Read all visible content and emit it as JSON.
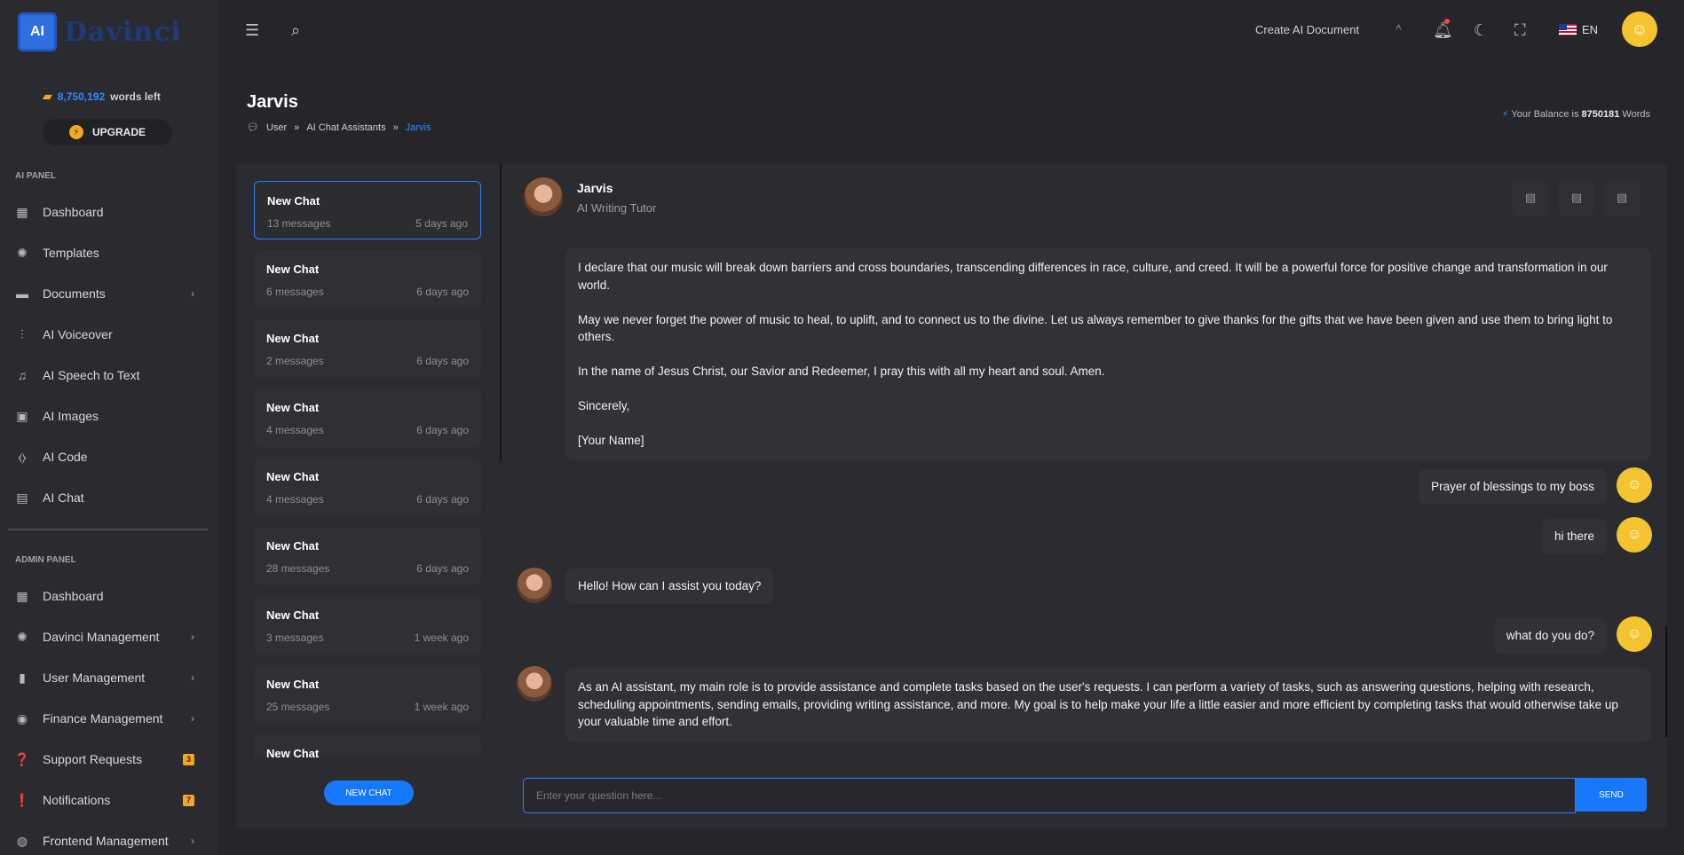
{
  "brand": {
    "logo_mark": "AI",
    "logo_text": "Davinci"
  },
  "colors": {
    "accent": "#1677ff",
    "badge": "#f5a623",
    "background": "#25262c"
  },
  "sidebar": {
    "words_count": "8,750,192",
    "words_label": "words left",
    "upgrade_label": "UPGRADE",
    "ai_panel_label": "AI PANEL",
    "ai_items": [
      {
        "label": "Dashboard",
        "icon": "dashboard-icon"
      },
      {
        "label": "Templates",
        "icon": "templates-icon"
      },
      {
        "label": "Documents",
        "icon": "folder-icon",
        "chevron": true
      },
      {
        "label": "AI Voiceover",
        "icon": "waveform-icon"
      },
      {
        "label": "AI Speech to Text",
        "icon": "audio-file-icon"
      },
      {
        "label": "AI Images",
        "icon": "image-icon"
      },
      {
        "label": "AI Code",
        "icon": "code-icon"
      },
      {
        "label": "AI Chat",
        "icon": "chat-icon"
      }
    ],
    "admin_panel_label": "ADMIN PANEL",
    "admin_items": [
      {
        "label": "Dashboard",
        "icon": "dashboard-icon"
      },
      {
        "label": "Davinci Management",
        "icon": "chip-icon",
        "chevron": true
      },
      {
        "label": "User Management",
        "icon": "user-badge-icon",
        "chevron": true
      },
      {
        "label": "Finance Management",
        "icon": "money-bag-icon",
        "chevron": true
      },
      {
        "label": "Support Requests",
        "icon": "question-icon",
        "badge": "3"
      },
      {
        "label": "Notifications",
        "icon": "alert-icon",
        "badge": "7"
      },
      {
        "label": "Frontend Management",
        "icon": "globe-icon",
        "chevron": true
      }
    ]
  },
  "topbar": {
    "create_doc_label": "Create AI Document",
    "language": "EN"
  },
  "header": {
    "title": "Jarvis",
    "breadcrumb": [
      "User",
      "AI Chat Assistants",
      "Jarvis"
    ],
    "balance_prefix": "Your Balance is",
    "balance_value": "8750181",
    "balance_suffix": "Words"
  },
  "chat_list": [
    {
      "title": "New Chat",
      "messages": "13 messages",
      "date": "5 days ago",
      "active": true
    },
    {
      "title": "New Chat",
      "messages": "6 messages",
      "date": "6 days ago"
    },
    {
      "title": "New Chat",
      "messages": "2 messages",
      "date": "6 days ago"
    },
    {
      "title": "New Chat",
      "messages": "4 messages",
      "date": "6 days ago"
    },
    {
      "title": "New Chat",
      "messages": "4 messages",
      "date": "6 days ago"
    },
    {
      "title": "New Chat",
      "messages": "28 messages",
      "date": "6 days ago"
    },
    {
      "title": "New Chat",
      "messages": "3 messages",
      "date": "1 week ago"
    },
    {
      "title": "New Chat",
      "messages": "25 messages",
      "date": "1 week ago"
    },
    {
      "title": "New Chat",
      "messages": "",
      "date": ""
    }
  ],
  "new_chat_label": "NEW CHAT",
  "assistant": {
    "name": "Jarvis",
    "role": "AI Writing Tutor"
  },
  "messages": {
    "bot1": [
      "I declare that our music will break down barriers and cross boundaries, transcending differences in race, culture, and creed. It will be a powerful force for positive change and transformation in our world.",
      "May we never forget the power of music to heal, to uplift, and to connect us to the divine. Let us always remember to give thanks for the gifts that we have been given and use them to bring light to others.",
      "In the name of Jesus Christ, our Savior and Redeemer, I pray this with all my heart and soul. Amen.",
      "Sincerely,",
      "[Your Name]"
    ],
    "user1": "Prayer of blessings to my boss",
    "user2": "hi there",
    "bot2": "Hello! How can I assist you today?",
    "user3": "what do you do?",
    "bot3": "As an AI assistant, my main role is to provide assistance and complete tasks based on the user's requests. I can perform a variety of tasks, such as answering questions, helping with research, scheduling appointments, sending emails, providing writing assistance, and more. My goal is to help make your life a little easier and more efficient by completing tasks that would otherwise take up your valuable time and effort."
  },
  "input": {
    "placeholder": "Enter your question here...",
    "value": ""
  },
  "send_label": "SEND"
}
